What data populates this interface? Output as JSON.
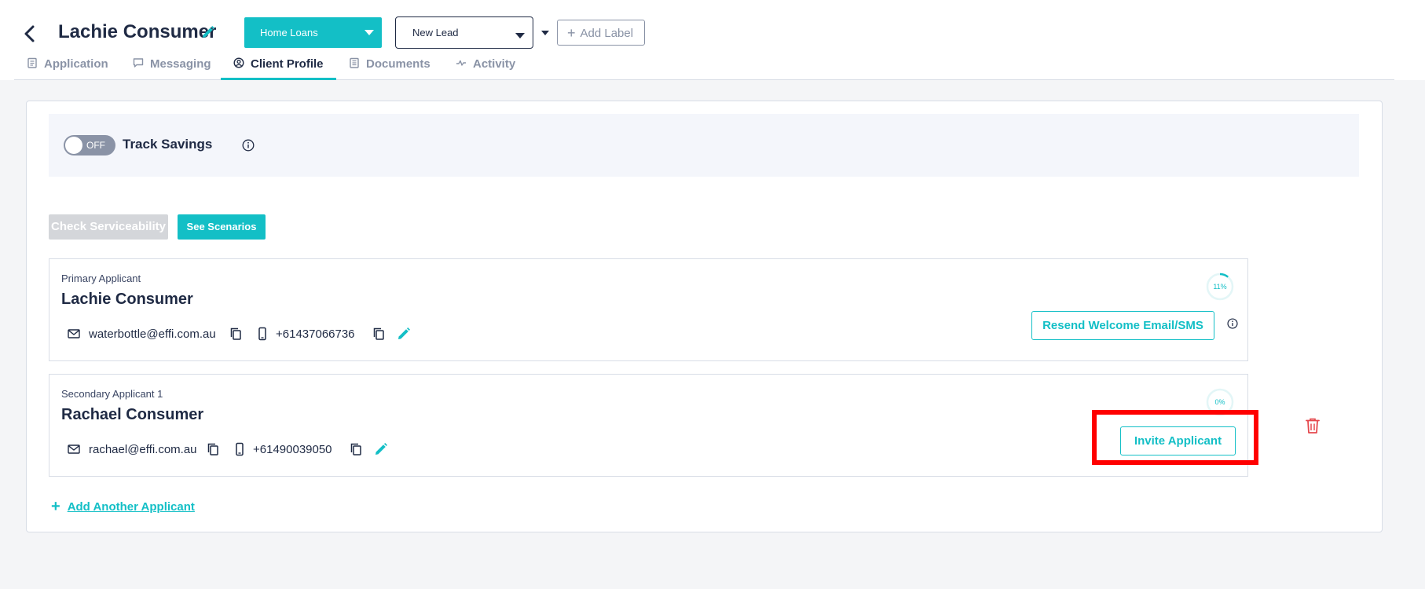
{
  "header": {
    "title": "Lachie Consumer",
    "product": "Home Loans",
    "status": "New Lead",
    "add_label": "Add Label"
  },
  "tabs": [
    {
      "label": "Application",
      "icon": "clipboard-icon"
    },
    {
      "label": "Messaging",
      "icon": "message-icon"
    },
    {
      "label": "Client Profile",
      "icon": "user-circle-icon",
      "active": true
    },
    {
      "label": "Documents",
      "icon": "document-icon"
    },
    {
      "label": "Activity",
      "icon": "activity-icon"
    }
  ],
  "savings": {
    "toggle_state": "OFF",
    "label": "Track Savings"
  },
  "actions": {
    "check_serviceability": "Check Serviceability",
    "see_scenarios": "See Scenarios"
  },
  "applicants": [
    {
      "role": "Primary Applicant",
      "name": "Lachie Consumer",
      "email": "waterbottle@effi.com.au",
      "phone": "+61437066736",
      "progress": "11%",
      "progress_value": 0.11,
      "action": "Resend Welcome Email/SMS"
    },
    {
      "role": "Secondary Applicant 1",
      "name": "Rachael Consumer",
      "email": "rachael@effi.com.au",
      "phone": "+61490039050",
      "progress": "0%",
      "progress_value": 0,
      "action": "Invite Applicant"
    }
  ],
  "add_applicant": "Add Another Applicant",
  "colors": {
    "accent": "#13bfc6",
    "text": "#1f2a44",
    "muted": "#8a93a6",
    "danger": "#e5484d",
    "highlight": "#ff0000"
  }
}
